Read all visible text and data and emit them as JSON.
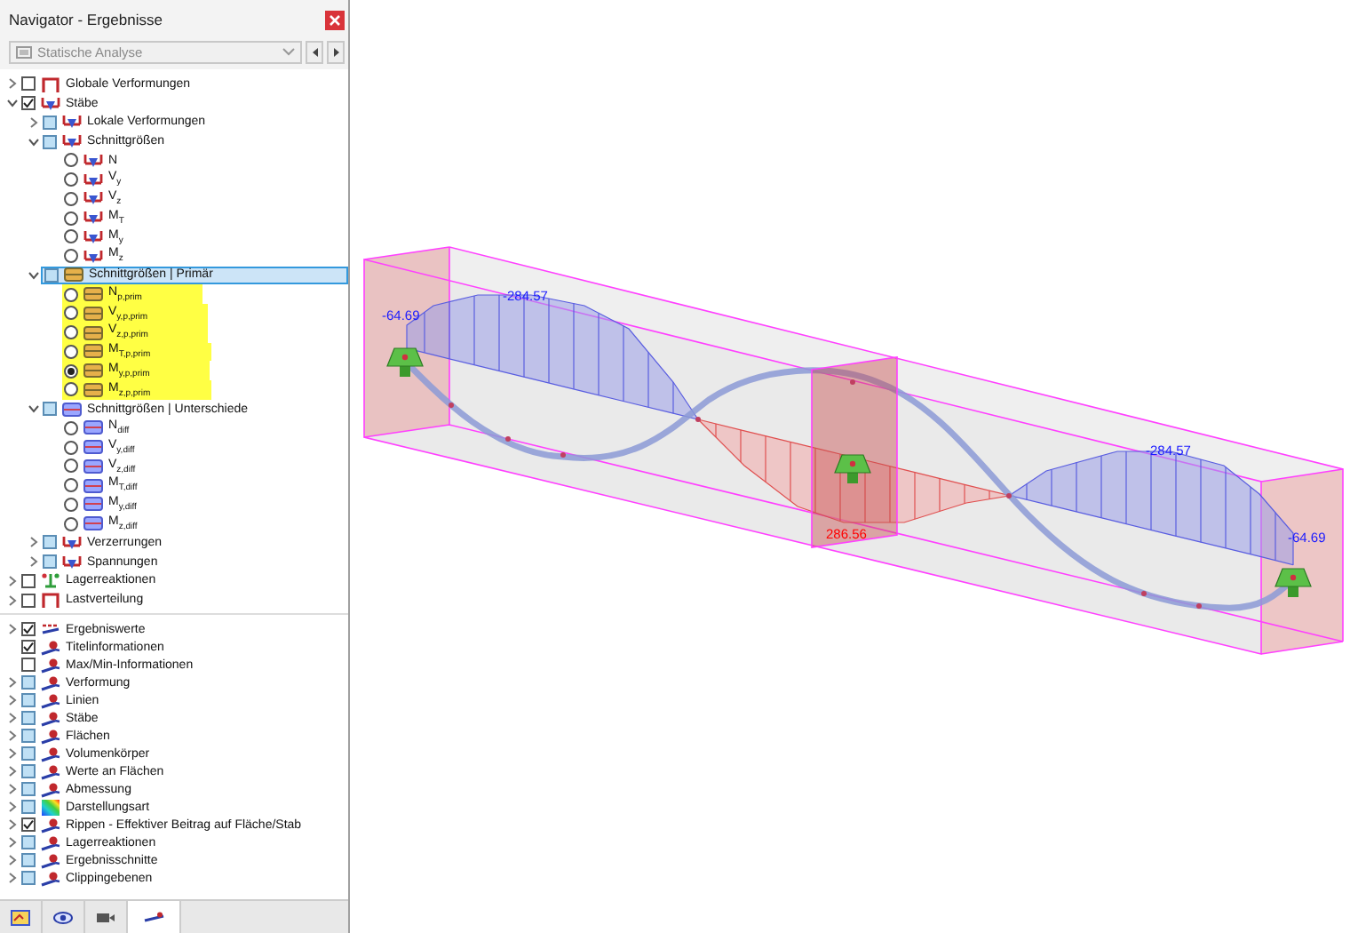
{
  "navigator": {
    "title": "Navigator - Ergebnisse",
    "dropdown": {
      "value": "Statische Analyse",
      "disabled": true
    },
    "trees": [
      [
        {
          "label": "Globale Verformungen",
          "icon": {
            "kind": "deformation"
          },
          "kind": "checkbox",
          "checked": false,
          "expanded": false,
          "selected": false
        },
        {
          "label": "Stäbe",
          "icon": {
            "kind": "member"
          },
          "kind": "checkbox",
          "checked": true,
          "expanded": true,
          "selected": false,
          "children": [
            {
              "label": "Lokale Verformungen",
              "icon": {
                "kind": "member"
              },
              "kind": "checkbox",
              "checked": false,
              "mixed": true,
              "expanded": false,
              "selected": false
            },
            {
              "label": "Schnittgrößen",
              "icon": {
                "kind": "member"
              },
              "kind": "checkbox",
              "checked": false,
              "mixed": true,
              "expanded": true,
              "selected": false,
              "children": [
                {
                  "label": "N",
                  "icon": {
                    "kind": "member"
                  },
                  "kind": "radio",
                  "checked": false,
                  "selected": false
                },
                {
                  "label": "V$_{y}$",
                  "icon": {
                    "kind": "member"
                  },
                  "kind": "radio",
                  "checked": false,
                  "selected": false
                },
                {
                  "label": "V$_{z}$",
                  "icon": {
                    "kind": "member"
                  },
                  "kind": "radio",
                  "checked": false,
                  "selected": false
                },
                {
                  "label": "M$_{T}$",
                  "icon": {
                    "kind": "member"
                  },
                  "kind": "radio",
                  "checked": false,
                  "selected": false
                },
                {
                  "label": "M$_{y}$",
                  "icon": {
                    "kind": "member"
                  },
                  "kind": "radio",
                  "checked": false,
                  "selected": false
                },
                {
                  "label": "M$_{z}$",
                  "icon": {
                    "kind": "member"
                  },
                  "kind": "radio",
                  "checked": false,
                  "selected": false
                }
              ]
            },
            {
              "label": "Schnittgrößen | Primär",
              "icon": {
                "kind": "primary"
              },
              "kind": "checkbox",
              "checked": false,
              "mixed": true,
              "expanded": true,
              "selected": true,
              "children": [
                {
                  "label": "N$_{p,prim}$",
                  "icon": {
                    "kind": "primary"
                  },
                  "kind": "radio",
                  "checked": false,
                  "selected": false,
                  "highlighted": true
                },
                {
                  "label": "V$_{y,p,prim}$",
                  "icon": {
                    "kind": "primary"
                  },
                  "kind": "radio",
                  "checked": false,
                  "selected": false,
                  "highlighted": true
                },
                {
                  "label": "V$_{z,p,prim}$",
                  "icon": {
                    "kind": "primary"
                  },
                  "kind": "radio",
                  "checked": false,
                  "selected": false,
                  "highlighted": true
                },
                {
                  "label": "M$_{T,p,prim}$",
                  "icon": {
                    "kind": "primary"
                  },
                  "kind": "radio",
                  "checked": false,
                  "selected": false,
                  "highlighted": true
                },
                {
                  "label": "M$_{y,p,prim}$",
                  "icon": {
                    "kind": "primary"
                  },
                  "kind": "radio",
                  "checked": true,
                  "selected": false,
                  "highlighted": true
                },
                {
                  "label": "M$_{z,p,prim}$",
                  "icon": {
                    "kind": "primary"
                  },
                  "kind": "radio",
                  "checked": false,
                  "selected": false,
                  "highlighted": true
                }
              ]
            },
            {
              "label": "Schnittgrößen | Unterschiede",
              "icon": {
                "kind": "difference"
              },
              "kind": "checkbox",
              "checked": false,
              "mixed": true,
              "expanded": true,
              "selected": false,
              "children": [
                {
                  "label": "N$_{diff}$",
                  "icon": {
                    "kind": "difference"
                  },
                  "kind": "radio",
                  "checked": false,
                  "selected": false
                },
                {
                  "label": "V$_{y,diff}$",
                  "icon": {
                    "kind": "difference"
                  },
                  "kind": "radio",
                  "checked": false,
                  "selected": false
                },
                {
                  "label": "V$_{z,diff}$",
                  "icon": {
                    "kind": "difference"
                  },
                  "kind": "radio",
                  "checked": false,
                  "selected": false
                },
                {
                  "label": "M$_{T,diff}$",
                  "icon": {
                    "kind": "difference"
                  },
                  "kind": "radio",
                  "checked": false,
                  "selected": false
                },
                {
                  "label": "M$_{y,diff}$",
                  "icon": {
                    "kind": "difference"
                  },
                  "kind": "radio",
                  "checked": false,
                  "selected": false
                },
                {
                  "label": "M$_{z,diff}$",
                  "icon": {
                    "kind": "difference"
                  },
                  "kind": "radio",
                  "checked": false,
                  "selected": false
                }
              ]
            },
            {
              "label": "Verzerrungen",
              "icon": {
                "kind": "member"
              },
              "kind": "checkbox",
              "checked": false,
              "mixed": true,
              "expanded": false,
              "selected": false
            },
            {
              "label": "Spannungen",
              "icon": {
                "kind": "member"
              },
              "kind": "checkbox",
              "checked": false,
              "mixed": true,
              "expanded": false,
              "selected": false
            }
          ]
        },
        {
          "label": "Lagerreaktionen",
          "icon": {
            "kind": "support"
          },
          "kind": "checkbox",
          "checked": false,
          "expanded": false,
          "selected": false
        },
        {
          "label": "Lastverteilung",
          "icon": {
            "kind": "deformation"
          },
          "kind": "checkbox",
          "checked": false,
          "expanded": false,
          "selected": false
        }
      ],
      [
        {
          "label": "Ergebniswerte",
          "icon": {
            "kind": "values"
          },
          "kind": "checkbox",
          "checked": true,
          "expanded": false,
          "selected": false
        },
        {
          "label": "Titelinformationen",
          "icon": {
            "kind": "display"
          },
          "kind": "checkbox",
          "checked": true,
          "selected": false
        },
        {
          "label": "Max/Min-Informationen",
          "icon": {
            "kind": "display"
          },
          "kind": "checkbox",
          "checked": false,
          "selected": false
        },
        {
          "label": "Verformung",
          "icon": {
            "kind": "display"
          },
          "kind": "checkbox",
          "checked": false,
          "mixed": true,
          "expanded": false,
          "selected": false
        },
        {
          "label": "Linien",
          "icon": {
            "kind": "display"
          },
          "kind": "checkbox",
          "checked": false,
          "mixed": true,
          "expanded": false,
          "selected": false
        },
        {
          "label": "Stäbe",
          "icon": {
            "kind": "display"
          },
          "kind": "checkbox",
          "checked": false,
          "mixed": true,
          "expanded": false,
          "selected": false
        },
        {
          "label": "Flächen",
          "icon": {
            "kind": "display"
          },
          "kind": "checkbox",
          "checked": false,
          "mixed": true,
          "expanded": false,
          "selected": false
        },
        {
          "label": "Volumenkörper",
          "icon": {
            "kind": "display"
          },
          "kind": "checkbox",
          "checked": false,
          "mixed": true,
          "expanded": false,
          "selected": false
        },
        {
          "label": "Werte an Flächen",
          "icon": {
            "kind": "display"
          },
          "kind": "checkbox",
          "checked": false,
          "mixed": true,
          "expanded": false,
          "selected": false
        },
        {
          "label": "Abmessung",
          "icon": {
            "kind": "display"
          },
          "kind": "checkbox",
          "checked": false,
          "mixed": true,
          "expanded": false,
          "selected": false
        },
        {
          "label": "Darstellungsart",
          "icon": {
            "kind": "colors"
          },
          "kind": "checkbox",
          "checked": false,
          "mixed": true,
          "expanded": false,
          "selected": false
        },
        {
          "label": "Rippen - Effektiver Beitrag auf Fläche/Stab",
          "icon": {
            "kind": "display"
          },
          "kind": "checkbox",
          "checked": true,
          "expanded": false,
          "selected": false
        },
        {
          "label": "Lagerreaktionen",
          "icon": {
            "kind": "display"
          },
          "kind": "checkbox",
          "checked": false,
          "mixed": true,
          "expanded": false,
          "selected": false
        },
        {
          "label": "Ergebnisschnitte",
          "icon": {
            "kind": "display"
          },
          "kind": "checkbox",
          "checked": false,
          "mixed": true,
          "expanded": false,
          "selected": false
        },
        {
          "label": "Clippingebenen",
          "icon": {
            "kind": "display"
          },
          "kind": "checkbox",
          "checked": false,
          "mixed": true,
          "expanded": false,
          "selected": false
        }
      ]
    ],
    "bottom_tabs": [
      {
        "kind": "data",
        "selected": false
      },
      {
        "kind": "eye",
        "selected": false
      },
      {
        "kind": "camera",
        "selected": false
      },
      {
        "kind": "results",
        "selected": true
      }
    ]
  },
  "viewport": {
    "labels": [
      {
        "text": "-64.69",
        "color": "#1a1aff"
      },
      {
        "text": "-284.57",
        "color": "#1a1aff"
      },
      {
        "text": "286.56",
        "color": "#ff0000"
      },
      {
        "text": "-284.57",
        "color": "#1a1aff"
      },
      {
        "text": "-64.69",
        "color": "#1a1aff"
      }
    ]
  }
}
